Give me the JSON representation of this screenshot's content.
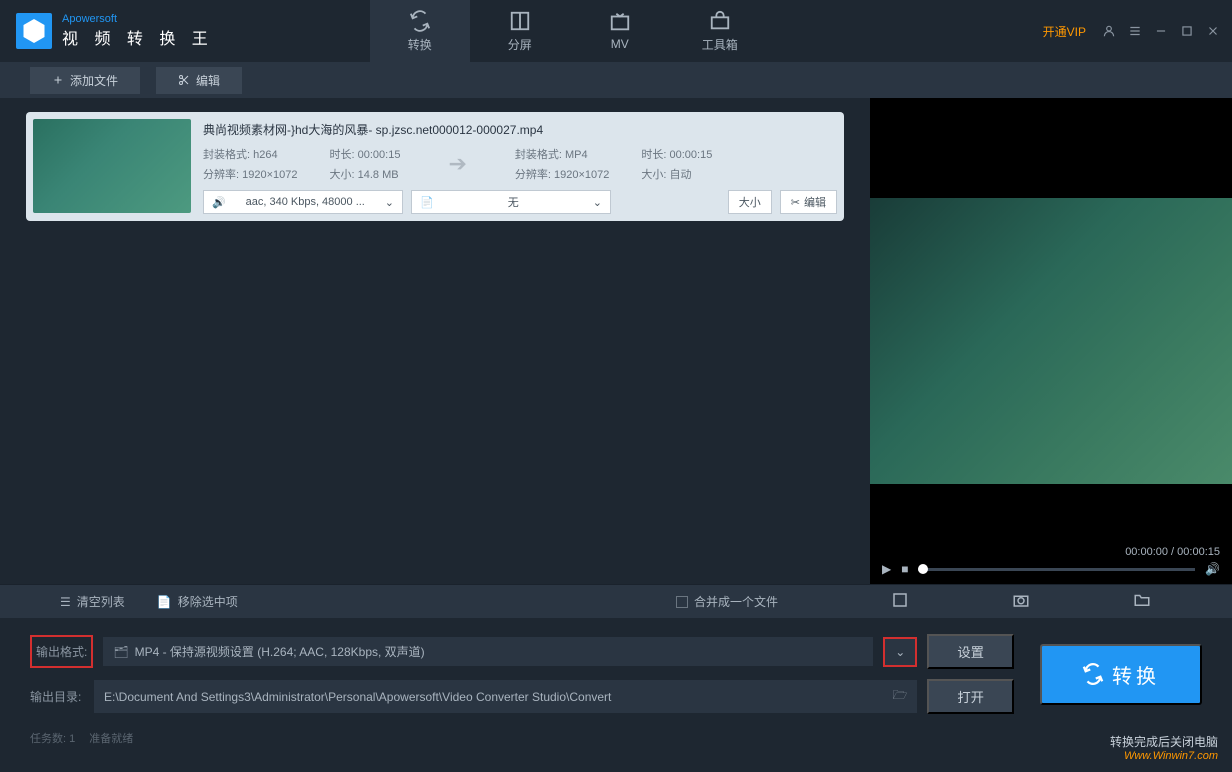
{
  "logo": {
    "brand": "Apowersoft",
    "title": "视 频 转 换 王"
  },
  "titlebar": {
    "vip": "开通VIP"
  },
  "mainTabs": {
    "convert": "转换",
    "split": "分屏",
    "mv": "MV",
    "toolbox": "工具箱"
  },
  "toolbar": {
    "addFile": "添加文件",
    "edit": "编辑"
  },
  "file": {
    "name": "典尚视频素材网-}hd大海的风暴- sp.jzsc.net000012-000027.mp4",
    "src": {
      "codecLabel": "封装格式:",
      "codec": "h264",
      "resLabel": "分辨率:",
      "res": "1920×1072",
      "durLabel": "时长:",
      "dur": "00:00:15",
      "sizeLabel": "大小:",
      "size": "14.8 MB"
    },
    "dst": {
      "codecLabel": "封装格式:",
      "codec": "MP4",
      "resLabel": "分辨率:",
      "res": "1920×1072",
      "durLabel": "时长:",
      "dur": "00:00:15",
      "sizeLabel": "大小:",
      "size": "自动"
    },
    "audioDropdown": "aac, 340 Kbps, 48000 ...",
    "subtitleDropdown": "无",
    "sizeBtn": "大小",
    "editBtn": "编辑"
  },
  "preview": {
    "time": "00:00:00 / 00:00:15"
  },
  "listActions": {
    "clear": "清空列表",
    "removeSel": "移除选中项",
    "mergeOne": "合并成一个文件"
  },
  "footer": {
    "formatLabel": "输出格式:",
    "format": "MP4 - 保持源视频设置 (H.264; AAC, 128Kbps, 双声道)",
    "settings": "设置",
    "dirLabel": "输出目录:",
    "dir": "E:\\Document And Settings3\\Administrator\\Personal\\Apowersoft\\Video Converter Studio\\Convert",
    "open": "打开",
    "convert": "转换"
  },
  "status": {
    "tasks": "任务数: 1",
    "ready": "准备就绪"
  },
  "watermark": {
    "line1": "转换完成后关闭电脑",
    "line2": "Www.Winwin7.com"
  }
}
